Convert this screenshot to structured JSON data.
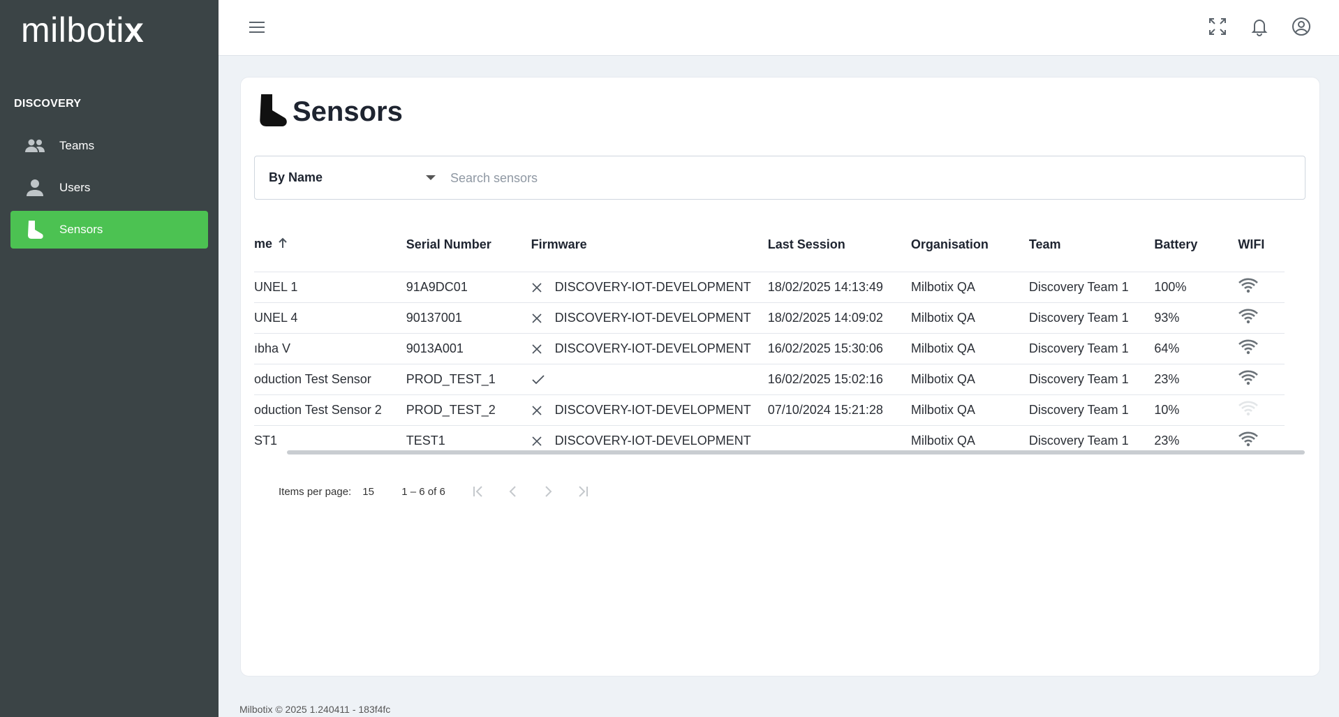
{
  "app": {
    "logo_text": "milboti",
    "logo_x": "x",
    "section": "DISCOVERY"
  },
  "sidebar": {
    "items": [
      {
        "label": "Teams",
        "icon": "group-icon",
        "active": false
      },
      {
        "label": "Users",
        "icon": "person-icon",
        "active": false
      },
      {
        "label": "Sensors",
        "icon": "sock-icon",
        "active": true
      }
    ]
  },
  "page": {
    "title": "Sensors"
  },
  "search": {
    "filter_selected": "By Name",
    "placeholder": "Search sensors",
    "value": ""
  },
  "table": {
    "columns": [
      "me",
      "Serial Number",
      "Firmware",
      "Last Session",
      "Organisation",
      "Team",
      "Battery",
      "WIFI"
    ],
    "rows": [
      {
        "name": "UNEL 1",
        "serial": "91A9DC01",
        "fw_ok": false,
        "firmware": "DISCOVERY-IOT-DEVELOPMENT",
        "last": "18/02/2025 14:13:49",
        "org": "Milbotix QA",
        "team": "Discovery Team 1",
        "battery": "100%",
        "wifi": "on"
      },
      {
        "name": "UNEL 4",
        "serial": "90137001",
        "fw_ok": false,
        "firmware": "DISCOVERY-IOT-DEVELOPMENT",
        "last": "18/02/2025 14:09:02",
        "org": "Milbotix QA",
        "team": "Discovery Team 1",
        "battery": "93%",
        "wifi": "on"
      },
      {
        "name": "ıbha V",
        "serial": "9013A001",
        "fw_ok": false,
        "firmware": "DISCOVERY-IOT-DEVELOPMENT",
        "last": "16/02/2025 15:30:06",
        "org": "Milbotix QA",
        "team": "Discovery Team 1",
        "battery": "64%",
        "wifi": "on"
      },
      {
        "name": "oduction Test Sensor",
        "serial": "PROD_TEST_1",
        "fw_ok": true,
        "firmware": "",
        "last": "16/02/2025 15:02:16",
        "org": "Milbotix QA",
        "team": "Discovery Team 1",
        "battery": "23%",
        "wifi": "on"
      },
      {
        "name": "oduction Test Sensor 2",
        "serial": "PROD_TEST_2",
        "fw_ok": false,
        "firmware": "DISCOVERY-IOT-DEVELOPMENT",
        "last": "07/10/2024 15:21:28",
        "org": "Milbotix QA",
        "team": "Discovery Team 1",
        "battery": "10%",
        "wifi": "off"
      },
      {
        "name": "ST1",
        "serial": "TEST1",
        "fw_ok": false,
        "firmware": "DISCOVERY-IOT-DEVELOPMENT",
        "last": "",
        "org": "Milbotix QA",
        "team": "Discovery Team 1",
        "battery": "23%",
        "wifi": "on"
      }
    ]
  },
  "paginator": {
    "label": "Items per page:",
    "page_size": "15",
    "range": "1 – 6 of 6"
  },
  "footer": {
    "text": "Milbotix © 2025 1.240411 - 183f4fc"
  },
  "colors": {
    "sidebar_bg": "#3b4446",
    "active_green": "#4cc252",
    "page_bg": "#eef2f6"
  }
}
